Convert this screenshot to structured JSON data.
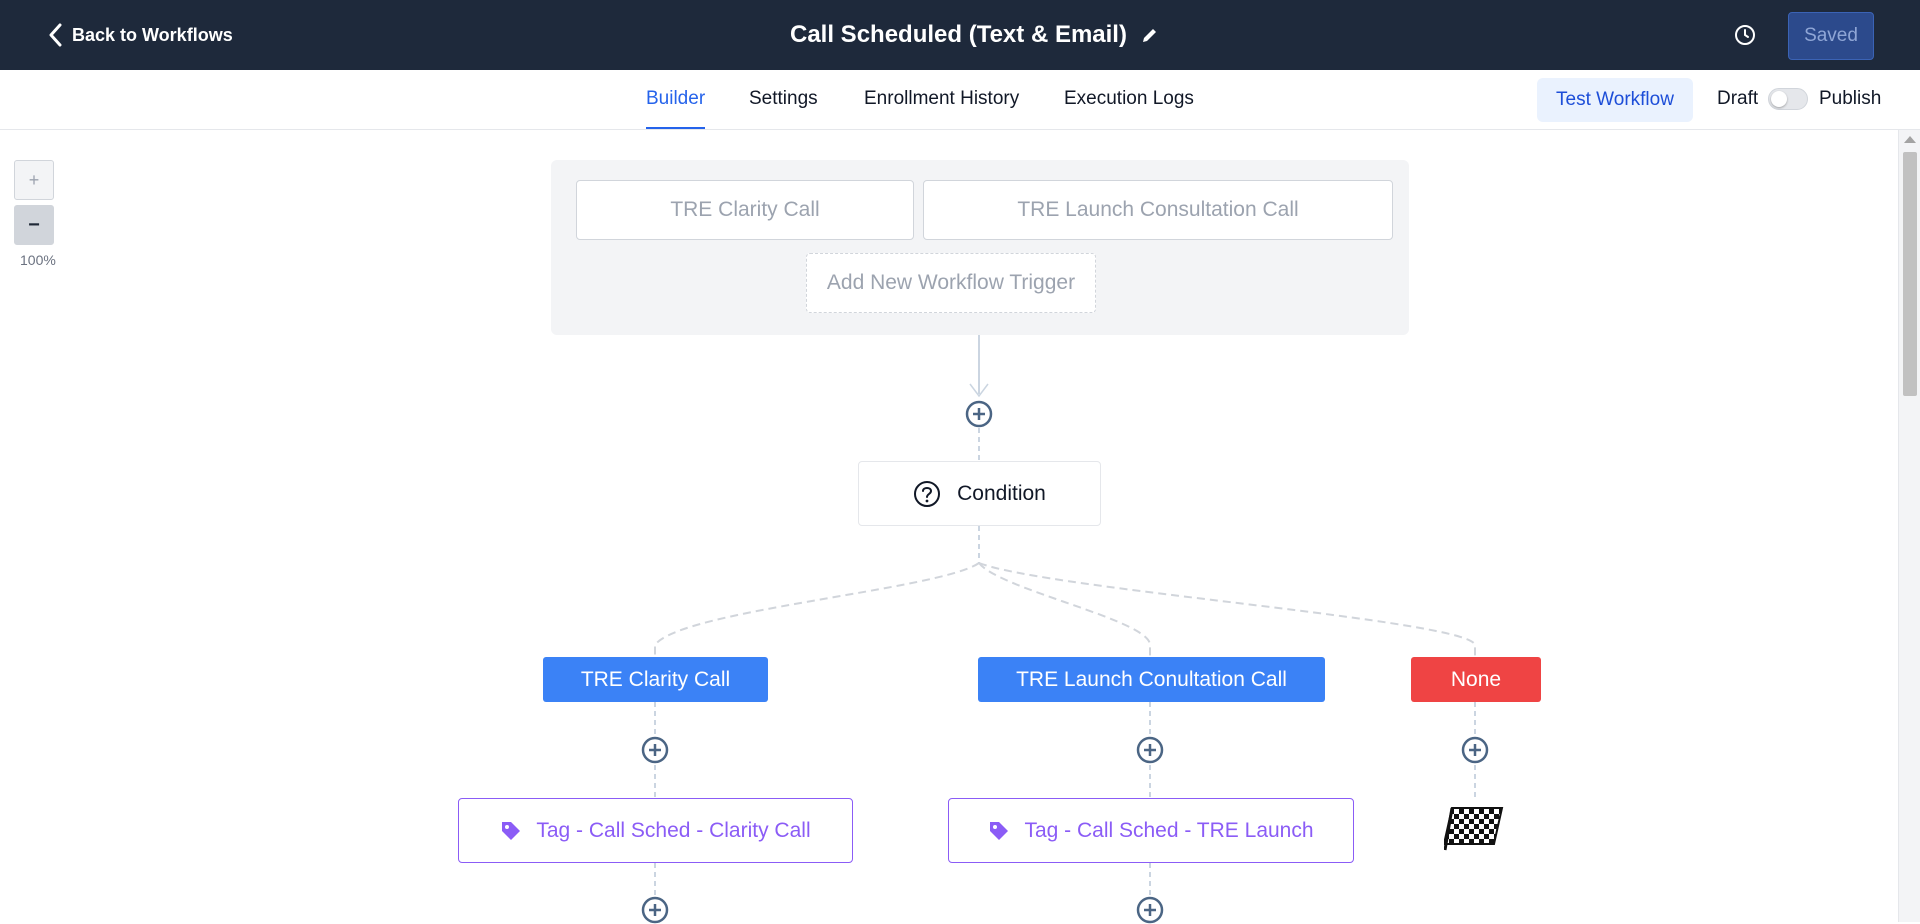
{
  "header": {
    "back_label": "Back to Workflows",
    "title": "Call Scheduled (Text & Email)",
    "saved_label": "Saved"
  },
  "tabs": [
    {
      "label": "Builder",
      "active": true
    },
    {
      "label": "Settings",
      "active": false
    },
    {
      "label": "Enrollment History",
      "active": false
    },
    {
      "label": "Execution Logs",
      "active": false
    }
  ],
  "actions": {
    "test_label": "Test Workflow",
    "draft_label": "Draft",
    "publish_label": "Publish",
    "published": false
  },
  "zoom": {
    "plus": "+",
    "minus": "−",
    "level": "100%"
  },
  "triggers": [
    "TRE Clarity Call",
    "TRE Launch Consultation Call"
  ],
  "add_trigger_label": "Add New Workflow Trigger",
  "condition_label": "Condition",
  "branches": [
    {
      "label": "TRE Clarity Call",
      "color": "#3b82f6"
    },
    {
      "label": "TRE Launch Conultation Call",
      "color": "#3b82f6"
    },
    {
      "label": "None",
      "color": "#ef4444"
    }
  ],
  "branch_actions": [
    "Tag - Call Sched - Clarity Call",
    "Tag - Call Sched - TRE Launch"
  ],
  "colors": {
    "topbar": "#1e293b",
    "accent": "#2563eb",
    "tag_purple": "#8b5cf6",
    "node_icon": "#4b6584"
  }
}
